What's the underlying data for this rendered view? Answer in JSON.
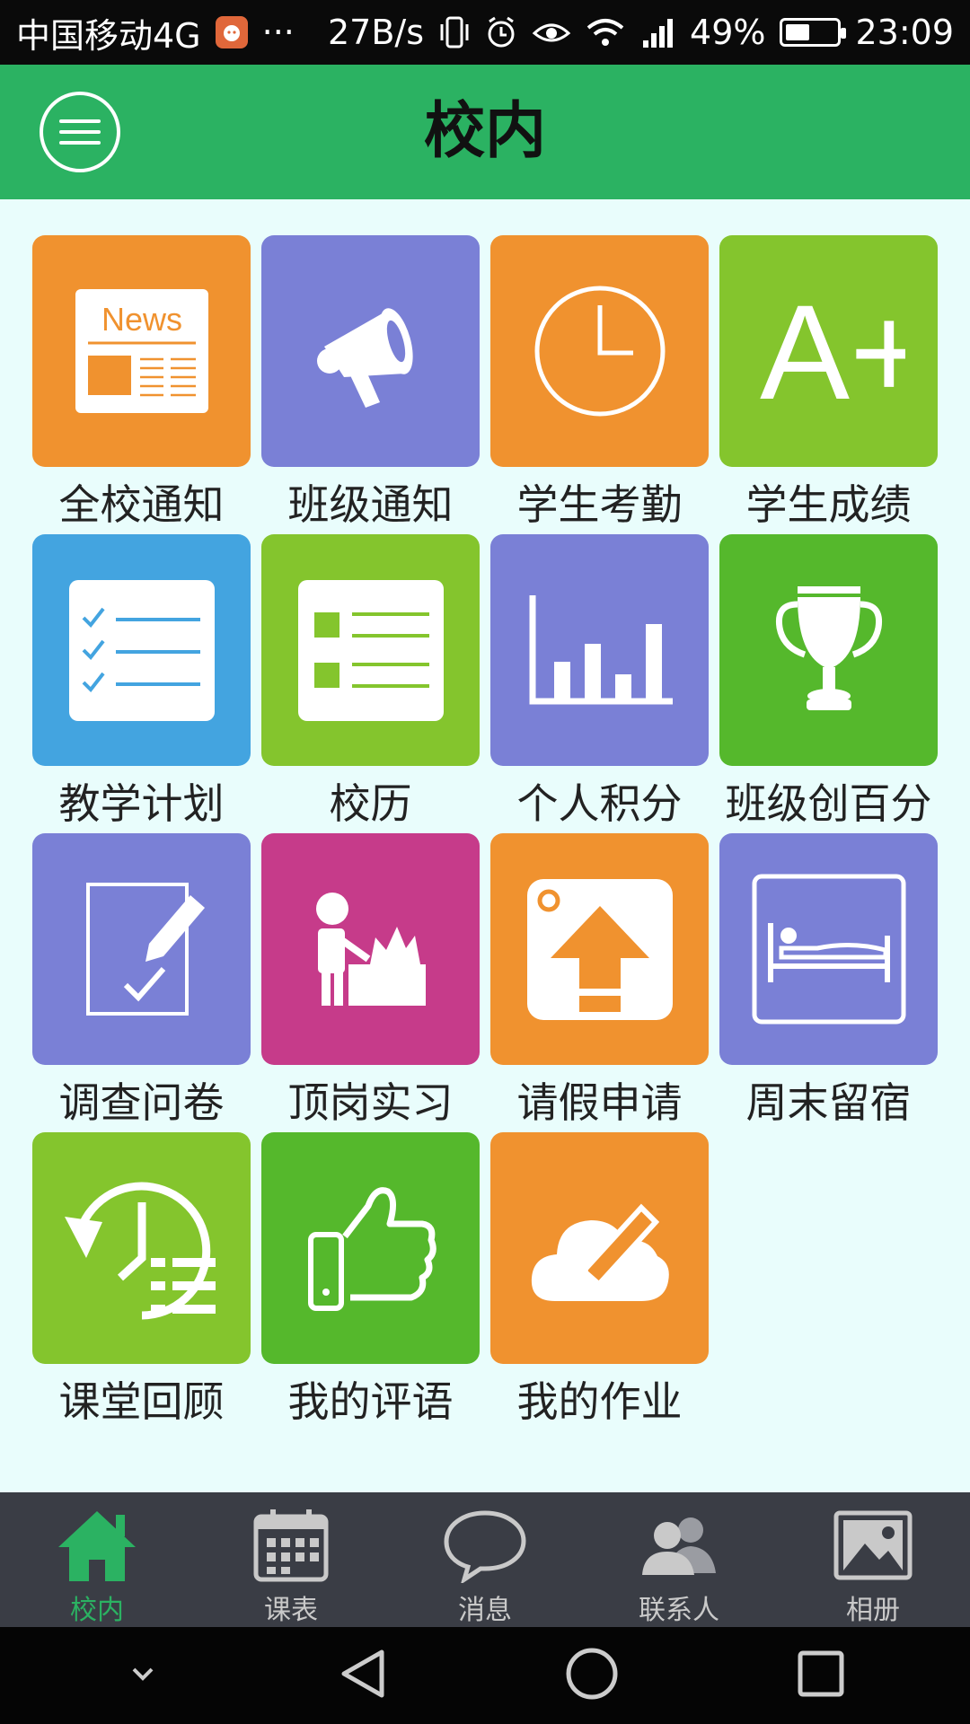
{
  "status_bar": {
    "carrier": "中国移动4G",
    "dots": "···",
    "speed": "27B/s",
    "battery_pct": "49%",
    "battery_level": 0.49,
    "time": "23:09"
  },
  "header": {
    "title": "校内",
    "menu_icon": "menu-icon"
  },
  "colors": {
    "header_green": "#2bb262",
    "orange": "#f0922f",
    "purple": "#7a80d6",
    "lime": "#84c52d",
    "blue": "#43a4e0",
    "green": "#55b82c",
    "magenta": "#c63b8a",
    "content_bg": "#e9fdfc",
    "nav_bg": "#3a3d45"
  },
  "tiles": [
    {
      "label": "全校通知",
      "icon": "news-icon",
      "news_text": "News"
    },
    {
      "label": "班级通知",
      "icon": "megaphone-icon"
    },
    {
      "label": "学生考勤",
      "icon": "clock-icon"
    },
    {
      "label": "学生成绩",
      "icon": "grade-a-plus-icon",
      "glyph": "A+"
    },
    {
      "label": "教学计划",
      "icon": "checklist-icon"
    },
    {
      "label": "校历",
      "icon": "list-icon"
    },
    {
      "label": "个人积分",
      "icon": "bar-chart-icon"
    },
    {
      "label": "班级创百分",
      "icon": "trophy-icon"
    },
    {
      "label": "调查问卷",
      "icon": "survey-edit-icon"
    },
    {
      "label": "顶岗实习",
      "icon": "internship-icon"
    },
    {
      "label": "请假申请",
      "icon": "upload-icon"
    },
    {
      "label": "周末留宿",
      "icon": "bed-icon"
    },
    {
      "label": "课堂回顾",
      "icon": "history-icon"
    },
    {
      "label": "我的评语",
      "icon": "thumbs-up-icon"
    },
    {
      "label": "我的作业",
      "icon": "cloud-edit-icon"
    }
  ],
  "nav": [
    {
      "label": "校内",
      "icon": "home-icon",
      "active": true
    },
    {
      "label": "课表",
      "icon": "calendar-icon"
    },
    {
      "label": "消息",
      "icon": "chat-bubble-icon"
    },
    {
      "label": "联系人",
      "icon": "contacts-icon"
    },
    {
      "label": "相册",
      "icon": "photo-icon"
    }
  ],
  "system_nav": [
    "chevron-down-icon",
    "back-icon",
    "home-circle-icon",
    "recents-icon"
  ]
}
